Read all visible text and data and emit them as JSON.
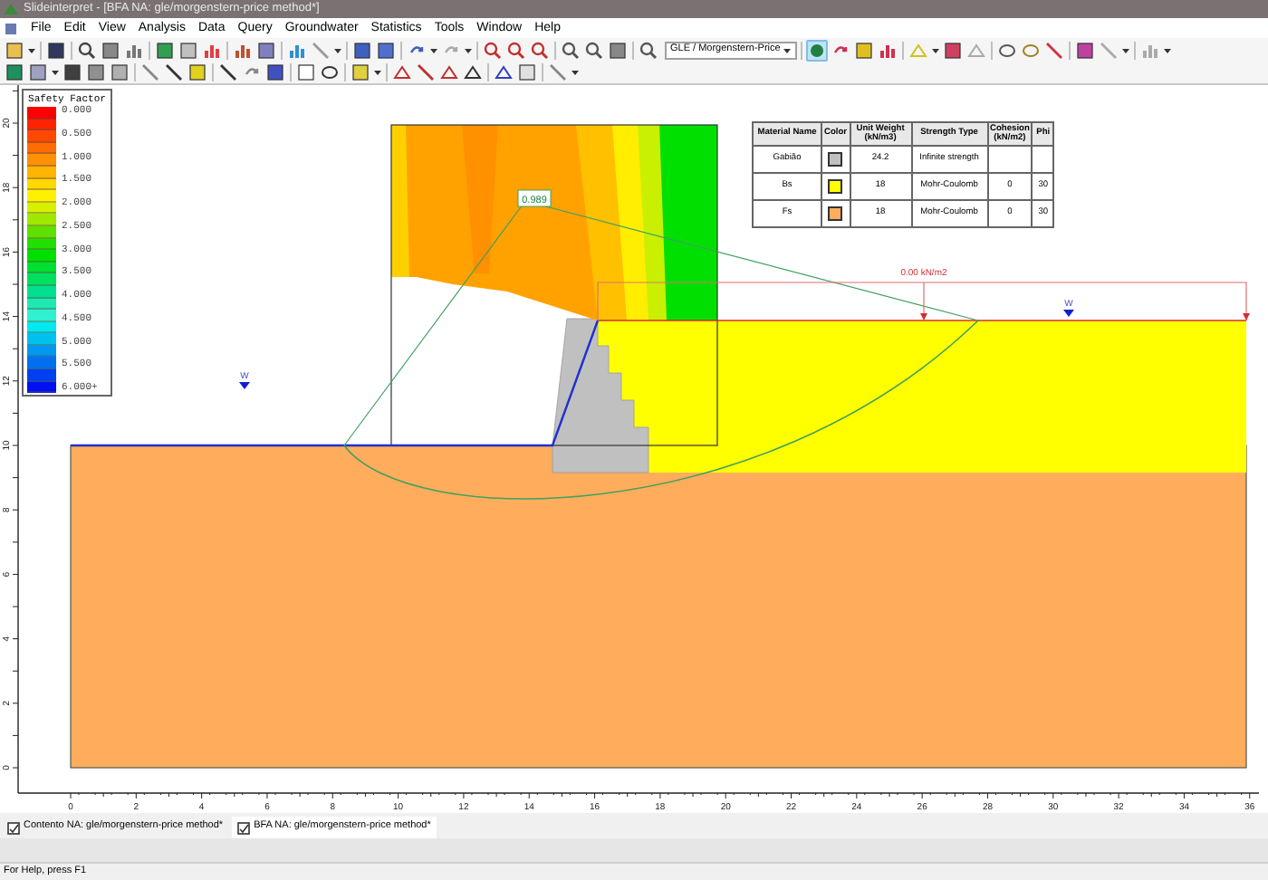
{
  "window": {
    "title": "Slideinterpret - [BFA NA: gle/morgenstern-price method*]"
  },
  "menu": {
    "items": [
      "File",
      "Edit",
      "View",
      "Analysis",
      "Data",
      "Query",
      "Groundwater",
      "Statistics",
      "Tools",
      "Window",
      "Help"
    ]
  },
  "toolbar": {
    "method": {
      "value": "GLE / Morgenstern-Price"
    },
    "toggles": [
      {
        "selected": true
      }
    ]
  },
  "legend": {
    "title": "Safety Factor",
    "bands": [
      {
        "color": "#ff0000"
      },
      {
        "color": "#ff2400"
      },
      {
        "color": "#ff4800"
      },
      {
        "color": "#ff6c00"
      },
      {
        "color": "#ff9000"
      },
      {
        "color": "#ffb400"
      },
      {
        "color": "#ffd800"
      },
      {
        "color": "#fff000"
      },
      {
        "color": "#d8f000"
      },
      {
        "color": "#a0e800"
      },
      {
        "color": "#60e000"
      },
      {
        "color": "#20e000"
      },
      {
        "color": "#00e000"
      },
      {
        "color": "#00e030"
      },
      {
        "color": "#00e060"
      },
      {
        "color": "#00e090"
      },
      {
        "color": "#20e8b0"
      },
      {
        "color": "#30f0d0"
      },
      {
        "color": "#00e8f0"
      },
      {
        "color": "#00c0f0"
      },
      {
        "color": "#0098f0"
      },
      {
        "color": "#0070f0"
      },
      {
        "color": "#0040f0"
      },
      {
        "color": "#0010f0"
      }
    ],
    "labels": [
      "0.000",
      "0.500",
      "1.000",
      "1.500",
      "2.000",
      "2.500",
      "3.000",
      "3.500",
      "4.000",
      "4.500",
      "5.000",
      "5.500",
      "6.000+"
    ]
  },
  "table": {
    "columns": [
      "Material Name",
      "Color",
      "Unit Weight (kN/m3)",
      "Strength Type",
      "Cohesion (kN/m2)",
      "Phi"
    ],
    "rows": [
      {
        "name": "Gabião",
        "color": "#c0c0c0",
        "unit_weight": "24.2",
        "strength_type": "Infinite strength"
      },
      {
        "name": "Bs",
        "color": "#ffff00",
        "unit_weight": "18",
        "strength_type": "Mohr-Coulomb",
        "cohesion": "0",
        "phi": "30"
      },
      {
        "name": "Fs",
        "color": "#ffad5c",
        "unit_weight": "18",
        "strength_type": "Mohr-Coulomb",
        "cohesion": "0",
        "phi": "30"
      }
    ]
  },
  "model": {
    "safety_factor": "0.989",
    "load_label": "0.00 kN/m2",
    "water_labels": [
      "W",
      "W"
    ]
  },
  "x_axis": {
    "labels": [
      "0",
      "2",
      "4",
      "6",
      "8",
      "10",
      "12",
      "14",
      "16",
      "18",
      "20",
      "22",
      "24",
      "26",
      "28",
      "30",
      "32",
      "34",
      "36"
    ]
  },
  "y_axis": {
    "labels": [
      "20",
      "18",
      "16",
      "14",
      "12",
      "10",
      "8",
      "6",
      "4",
      "2",
      "0"
    ]
  },
  "tabs": [
    {
      "label": "Contento NA: gle/morgenstern-price method*",
      "selected": false
    },
    {
      "label": "BFA NA: gle/morgenstern-price method*",
      "selected": true
    }
  ],
  "status_bar": {
    "text": "For Help, press F1"
  }
}
